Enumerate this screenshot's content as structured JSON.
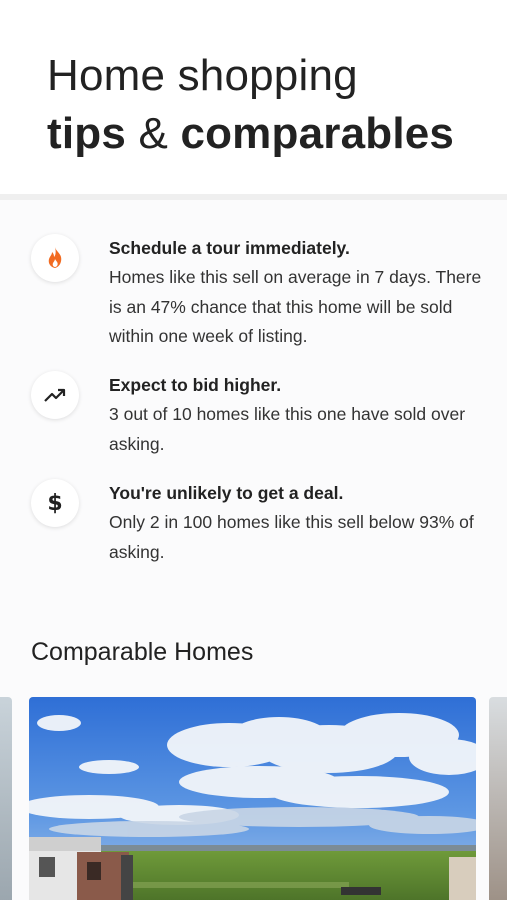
{
  "header": {
    "title_line1": "Home shopping",
    "title_line2_bold_a": "tips",
    "title_line2_amp": " & ",
    "title_line2_bold_b": "comparables"
  },
  "tips": [
    {
      "icon": "fire-icon",
      "heading": "Schedule a tour immediately.",
      "body": "Homes like this sell on average in 7 days. There is an 47% chance that this home will be sold within one week of listing.",
      "icon_color": "#f26b21"
    },
    {
      "icon": "trending-up-icon",
      "heading": "Expect to bid higher.",
      "body": "3 out of 10 homes like this one have sold over asking.",
      "icon_color": "#222222"
    },
    {
      "icon": "dollar-icon",
      "heading": "You're unlikely to get a deal.",
      "body": "Only 2 in 100 homes like this sell below 93% of asking.",
      "icon_color": "#222222"
    }
  ],
  "comparables": {
    "title": "Comparable Homes"
  },
  "colors": {
    "divider": "#efefef",
    "tips_background": "#fbfbfc"
  }
}
